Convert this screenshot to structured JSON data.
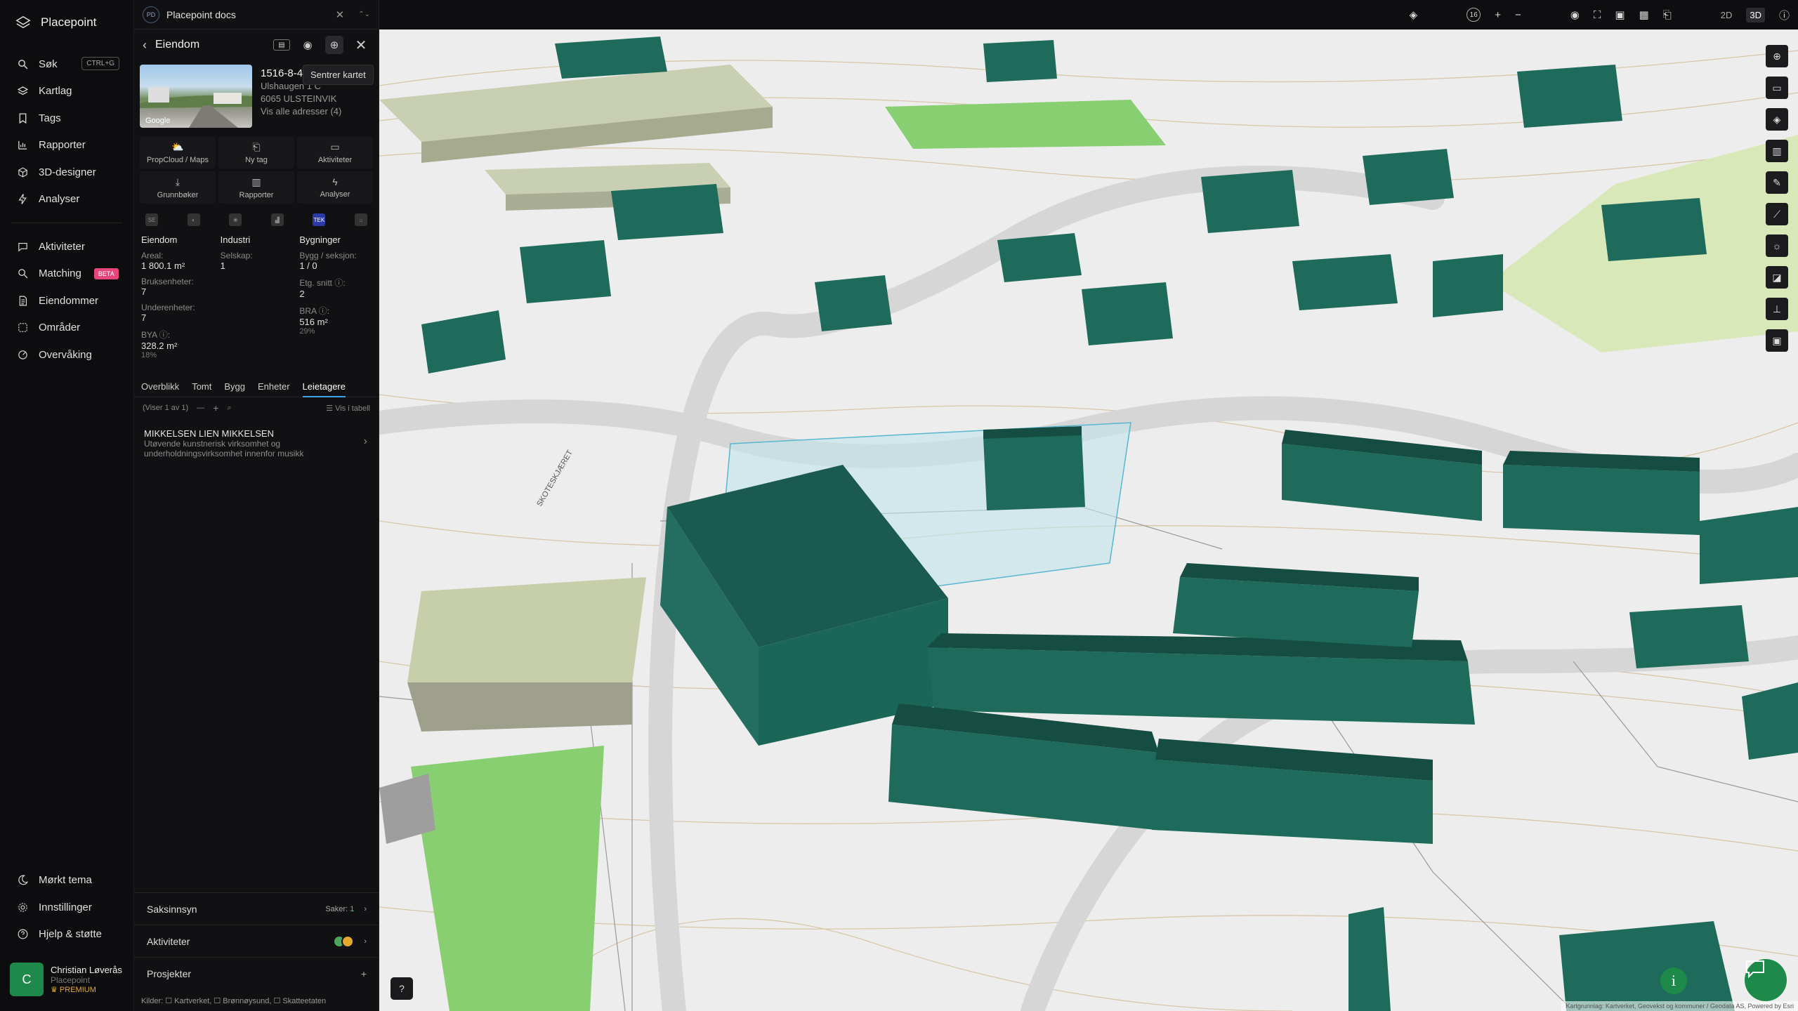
{
  "app": {
    "name": "Placepoint"
  },
  "nav": {
    "items": [
      {
        "label": "Søk",
        "kbd": "CTRL+G"
      },
      {
        "label": "Kartlag"
      },
      {
        "label": "Tags"
      },
      {
        "label": "Rapporter"
      },
      {
        "label": "3D-designer"
      },
      {
        "label": "Analyser"
      }
    ],
    "items2": [
      {
        "label": "Aktiviteter"
      },
      {
        "label": "Matching",
        "badge": "BETA"
      },
      {
        "label": "Eiendommer"
      },
      {
        "label": "Områder"
      },
      {
        "label": "Overvåking"
      }
    ],
    "bottom": [
      {
        "label": "Mørkt tema"
      },
      {
        "label": "Innstillinger"
      },
      {
        "label": "Hjelp & støtte"
      }
    ],
    "user": {
      "initial": "C",
      "name": "Christian Løverås",
      "org": "Placepoint",
      "plan": "PREMIUM"
    }
  },
  "panel": {
    "tab": {
      "badge": "PD",
      "title": "Placepoint docs"
    },
    "header": {
      "title": "Eiendom",
      "tooltip": "Sentrer kartet"
    },
    "property": {
      "id": "1516-8-4",
      "address": "Ulshaugen 1 C",
      "postal": "6065 ULSTEINVIK",
      "all_addresses": "Vis alle adresser (4)",
      "photo_credit": "Google"
    },
    "actions": [
      {
        "label": "PropCloud / Maps",
        "icon": "⛅"
      },
      {
        "label": "Ny tag",
        "icon": "🔖"
      },
      {
        "label": "Aktiviteter",
        "icon": "💬"
      },
      {
        "label": "Grunnbøker",
        "icon": "⤓"
      },
      {
        "label": "Rapporter",
        "icon": "▥"
      },
      {
        "label": "Analyser",
        "icon": "⚲"
      }
    ],
    "sources": [
      "SE",
      "◐",
      "❀",
      "▟",
      "TEK",
      "⌂"
    ],
    "stats": {
      "col1": {
        "head": "Eiendom",
        "rows": [
          {
            "k": "Areal:",
            "v": "1 800.1 m²"
          },
          {
            "k": "Bruksenheter:",
            "v": "7"
          },
          {
            "k": "Underenheter:",
            "v": "7"
          },
          {
            "k": "BYA ⓘ:",
            "v": "328.2 m²",
            "p": "18%"
          }
        ]
      },
      "col2": {
        "head": "Industri",
        "rows": [
          {
            "k": "Selskap:",
            "v": "1"
          }
        ]
      },
      "col3": {
        "head": "Bygninger",
        "rows": [
          {
            "k": "Bygg / seksjon:",
            "v": "1 / 0"
          },
          {
            "k": "Etg. snitt ⓘ:",
            "v": "2"
          },
          {
            "k": "BRA ⓘ:",
            "v": "516 m²",
            "p": "29%"
          }
        ]
      }
    },
    "tabs": [
      "Overblikk",
      "Tomt",
      "Bygg",
      "Enheter",
      "Leietagere"
    ],
    "list": {
      "count": "(Viser 1 av 1)",
      "table": "Vis i tabell"
    },
    "tenant": {
      "name": "MIKKELSEN LIEN MIKKELSEN",
      "desc1": "Utøvende kunstnerisk virksomhet og",
      "desc2": "underholdningsvirksomhet innenfor musikk"
    },
    "sections": [
      {
        "label": "Saksinnsyn",
        "extra": "Saker:",
        "count": "1"
      },
      {
        "label": "Aktiviteter"
      },
      {
        "label": "Prosjekter"
      }
    ],
    "sources_line": "Kilder: ☐ Kartverket, ☐ Brønnøysund, ☐ Skatteetaten"
  },
  "topbar": {
    "zoom": "16",
    "mode2d": "2D",
    "mode3d": "3D"
  },
  "map": {
    "attribution": "Kartgrunnlag: Kartverket, Geovekst og kommuner / Geodata AS, Powered by Esri",
    "road_label": "SKOTESKJÆRET"
  },
  "colors": {
    "building": "#1e6b5c",
    "building_dark": "#154d43",
    "building_light": "#c9cfb3",
    "grass": "#88cf72",
    "highlight": "#bfe4ec",
    "accent": "#1e8a4a"
  }
}
